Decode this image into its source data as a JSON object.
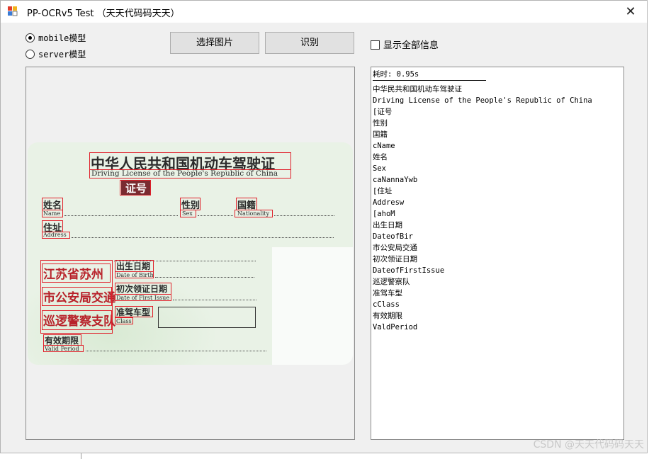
{
  "window": {
    "title": "PP-OCRv5 Test （天天代码码天天）",
    "close_symbol": "✕"
  },
  "model_options": [
    {
      "label": "mobile模型",
      "selected": true
    },
    {
      "label": "server模型",
      "selected": false
    }
  ],
  "buttons": {
    "choose_image": "选择图片",
    "recognize": "识别"
  },
  "show_all_checkbox": {
    "label": "显示全部信息",
    "checked": false
  },
  "license_card": {
    "title_cn": "中华人民共和国机动车驾驶证",
    "title_en": "Driving License of the People's Republic of China",
    "cert_no": "证号",
    "name_cn": "姓名",
    "name_en": "Name",
    "sex_cn": "性别",
    "sex_en": "Sex",
    "nationality_cn": "国籍",
    "nationality_en": "Nationality",
    "address_cn": "住址",
    "address_en": "Address",
    "dob_cn": "出生日期",
    "dob_en": "Date of Birth",
    "first_issue_cn": "初次领证日期",
    "first_issue_en": "Date of First Issue",
    "class_cn": "准驾车型",
    "class_en": "Class",
    "valid_cn": "有效期限",
    "valid_en": "Valid Period",
    "stamp_lines": [
      "江苏省苏州",
      "市公安局交通",
      "巡逻警察支队"
    ]
  },
  "results": {
    "time_label": "耗时: 0.95s",
    "lines": [
      "中华民共和国机动车驾驶证",
      "Driving License of the People's Republic of China",
      "[证号",
      "性别",
      "国籍",
      "cName",
      "姓名",
      "Sex",
      "caNannaYwb",
      "[住址",
      "Addresw",
      "[ahoM",
      "出生日期",
      "DateofBir",
      "市公安局交通",
      "初次领证日期",
      "DateofFirstIssue",
      "巡逻警察队",
      "准驾车型",
      "cClass",
      "有效期限",
      "ValdPeriod"
    ]
  },
  "watermark": "CSDN @天天代码码天天",
  "colors": {
    "accent_box": "#e0202a",
    "window_bg": "#f0f0f0"
  }
}
